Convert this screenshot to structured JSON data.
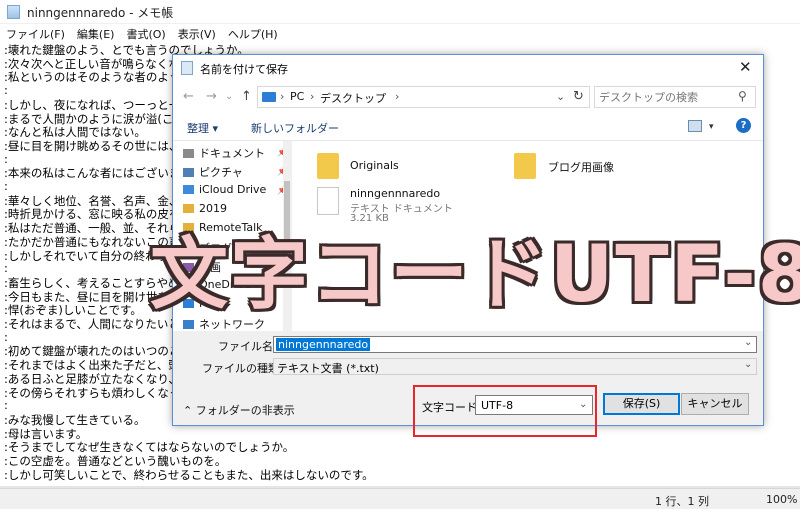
{
  "notepad": {
    "title": "ninngennnaredo - メモ帳",
    "menu": [
      "ファイル(F)",
      "編集(E)",
      "書式(O)",
      "表示(V)",
      "ヘルプ(H)"
    ],
    "lines": [
      ":壊れた鍵盤のよう、とでも言うのでしょうか。",
      ":次々次へと正しい音が鳴らなくなり、次",
      ":私というのはそのような者のように思う",
      ":",
      ":しかし、夜になれば、つーっと一雫。",
      ":まるで人間かのように涙が溢(こぼ)れ",
      ":なんと私は人間ではない。",
      ":昼に目を開け眺めるその世には、私の",
      ":",
      ":本来の私はこんな者にはございません",
      ":",
      ":華々しく地位、名誉、名声、金、友、",
      ":時折見かける、窓に映る私の皮を被っ",
      ":私はただ普通、一般、並、それらが嫌",
      ":たかだか普通にもなれないこの畜生は",
      ":しかしそれでいて自分の終わりを決め",
      ":",
      ":畜生らしく、考えることすらやめてしま",
      ":今日もまた、昼に目を開け世を眺め",
      ":悍(おぞま)しいことです。",
      ":それはまるで、人間になりたいと申して",
      ":",
      ":初めて鍵盤が壊れたのはいつのことで",
      ":それまではよく出来た子だと、頭のいい",
      ":ある日ふと足膝が立たなくなり、まず一",
      ":その傍らそれすらも煩わしくなっている",
      ":",
      ":みな我慢して生きている。",
      ":母は言います。",
      ":そうまでしてなぜ生きなくてはならないのでしょうか。",
      ":この空虚を。普通などという醜いものを。",
      ":しかし可笑しいことで、終わらせることもまた、出来はしないのです。"
    ],
    "status": {
      "position": "1 行、1 列",
      "zoom": "100%"
    }
  },
  "dialog": {
    "title": "名前を付けて保存",
    "close": "✕",
    "address": [
      "PC",
      "デスクトップ"
    ],
    "search_placeholder": "デスクトップの検索",
    "organize": "整理 ▾",
    "new_folder": "新しいフォルダー",
    "nav_items": [
      {
        "label": "ドキュメント",
        "pinned": true
      },
      {
        "label": "ピクチャ",
        "pinned": true
      },
      {
        "label": "iCloud Drive",
        "pinned": true
      },
      {
        "label": "2019",
        "pinned": false
      },
      {
        "label": "RemoteTalk",
        "pinned": false
      },
      {
        "label": "ブログ用画像",
        "pinned": false
      },
      {
        "label": "動画",
        "pinned": false
      },
      {
        "label": "OneDrive",
        "pinned": false
      },
      {
        "label": "PC",
        "pinned": false
      },
      {
        "label": "ネットワーク",
        "pinned": false
      }
    ],
    "files": [
      {
        "name": "Originals",
        "kind": "folder"
      },
      {
        "name": "ブログ用画像",
        "kind": "folder"
      },
      {
        "name": "ninngennnaredo",
        "kind": "text",
        "type": "テキスト ドキュメント",
        "size": "3.21 KB"
      }
    ],
    "filename_label": "ファイル名(N):",
    "filename_value": "ninngennnaredo",
    "filetype_label": "ファイルの種類(T):",
    "filetype_value": "テキスト文書 (*.txt)",
    "hide_folders": "フォルダーの非表示",
    "encoding_label": "文字コード(E):",
    "encoding_value": "UTF-8",
    "save": "保存(S)",
    "cancel": "キャンセル"
  },
  "overlay_caption": "文字コードUTF-8",
  "colors": {
    "accent": "#0078d7",
    "highlight_box": "#e8272d",
    "caption_fill": "#f7c8c8"
  }
}
